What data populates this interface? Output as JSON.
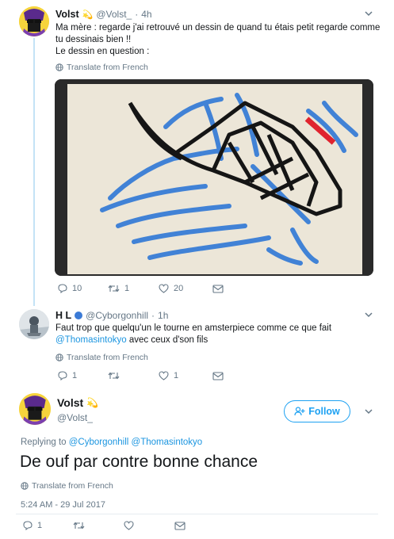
{
  "tweet1": {
    "name": "Volst",
    "badge": "💫",
    "handle": "@Volst_",
    "time": "4h",
    "text_line1": "Ma mère : regarde j'ai retrouvé un dessin de quand tu étais petit regarde comme",
    "text_line2": "tu dessinais bien !!",
    "text_line3": "Le dessin en question :",
    "translate": "Translate from French",
    "replies": "10",
    "retweets": "1",
    "likes": "20"
  },
  "tweet2": {
    "name": "H L",
    "handle": "@Cyborgonhill",
    "time": "1h",
    "text_line1": "Faut trop que quelqu'un le tourne en amsterpiece comme ce que fait",
    "mention": "@Thomasintokyo",
    "text_line2_rest": " avec ceux d'son fils",
    "translate": "Translate from French",
    "replies": "1",
    "likes": "1"
  },
  "main_tweet": {
    "name": "Volst",
    "badge": "💫",
    "handle": "@Volst_",
    "follow_label": "Follow",
    "replying_prefix": "Replying to ",
    "reply_to_1": "@Cyborgonhill",
    "reply_to_2": "@Thomasintokyo",
    "text": "De ouf par contre bonne chance",
    "translate": "Translate from French",
    "timestamp": "5:24 AM - 29 Jul 2017",
    "replies": "1"
  },
  "icons": {
    "reply": "reply-icon",
    "retweet": "retweet-icon",
    "like": "heart-icon",
    "dm": "envelope-icon",
    "globe": "globe-icon",
    "more": "chevron-down-icon",
    "follow": "person-plus-icon"
  },
  "colors": {
    "accent": "#1da1f2",
    "link": "#1b95e0",
    "muted": "#657786",
    "thread": "#c4e3f6"
  }
}
